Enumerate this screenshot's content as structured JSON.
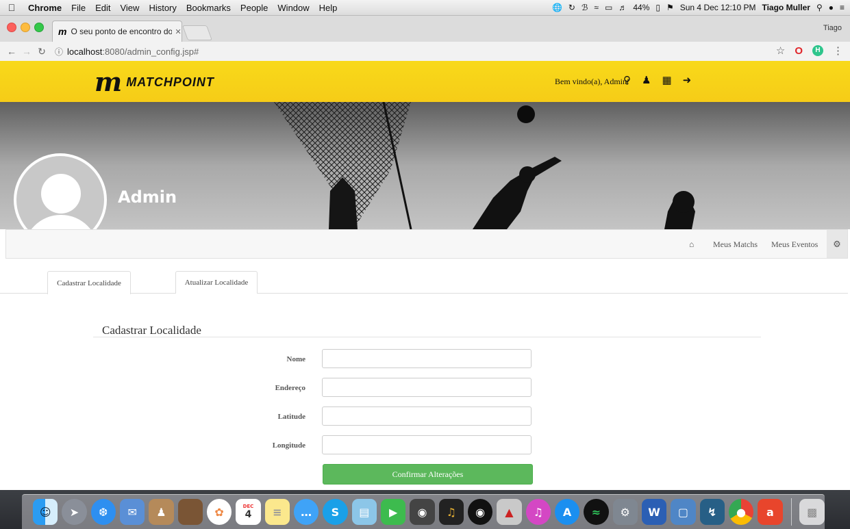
{
  "menubar": {
    "apple": "",
    "app_name": "Chrome",
    "menus": [
      "File",
      "Edit",
      "View",
      "History",
      "Bookmarks",
      "People",
      "Window",
      "Help"
    ],
    "battery": "44%",
    "datetime": "Sun 4 Dec  12:10 PM",
    "user": "Tiago Muller"
  },
  "browser": {
    "tab_title": "O seu ponto de encontro dos e",
    "tab_favicon": "m",
    "profile_name": "Tiago",
    "url_host": "localhost",
    "url_path": ":8080/admin_config.jsp#"
  },
  "header": {
    "logo_mark": "m",
    "logo_text": "MATCHPOINT",
    "welcome": "Bem vindo(a), Admin!"
  },
  "profile": {
    "name": "Admin"
  },
  "profile_nav": {
    "items": [
      "Meus Matchs",
      "Meus Eventos"
    ]
  },
  "config_tabs": {
    "tabs": [
      "Cadastrar Localidade",
      "Atualizar Localidade"
    ]
  },
  "form": {
    "title": "Cadastrar Localidade",
    "fields": {
      "nome": {
        "label": "Nome",
        "value": ""
      },
      "endereco": {
        "label": "Endereço",
        "value": ""
      },
      "latitude": {
        "label": "Latitude",
        "value": ""
      },
      "longitude": {
        "label": "Longitude",
        "value": ""
      }
    },
    "submit_label": "Confirmar Alterações"
  },
  "dock": {
    "apps": [
      "finder",
      "launchpad",
      "safari",
      "mail-preview",
      "contacts",
      "notes-brown",
      "photos",
      "calendar",
      "notes",
      "messages",
      "skype",
      "preview",
      "facetime",
      "photo-booth",
      "garageband",
      "dvd-player",
      "popcorn",
      "itunes",
      "app-store",
      "spotify",
      "system-preferences",
      "word",
      "virtualbox",
      "mysql-workbench",
      "chrome",
      "ask",
      "trash"
    ],
    "calendar_month": "DEC",
    "calendar_day": "4"
  },
  "colors": {
    "header_yellow": "#f8d91a",
    "submit_green": "#5cb85c"
  }
}
